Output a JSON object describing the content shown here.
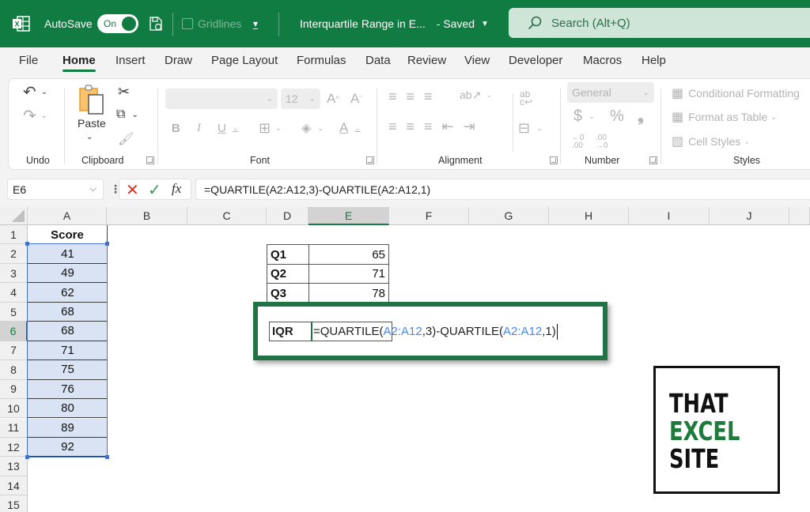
{
  "titlebar": {
    "autosave_label": "AutoSave",
    "autosave_state": "On",
    "gridlines_label": "Gridlines",
    "gridlines_checked": false,
    "doc_title": "Interquartile Range in E...",
    "save_status": "- Saved",
    "search_placeholder": "Search (Alt+Q)",
    "brand_color": "#107C41"
  },
  "tabs": [
    {
      "label": "File",
      "active": false
    },
    {
      "label": "Home",
      "active": true
    },
    {
      "label": "Insert",
      "active": false
    },
    {
      "label": "Draw",
      "active": false
    },
    {
      "label": "Page Layout",
      "active": false
    },
    {
      "label": "Formulas",
      "active": false
    },
    {
      "label": "Data",
      "active": false
    },
    {
      "label": "Review",
      "active": false
    },
    {
      "label": "View",
      "active": false
    },
    {
      "label": "Developer",
      "active": false
    },
    {
      "label": "Macros",
      "active": false
    },
    {
      "label": "Help",
      "active": false
    }
  ],
  "ribbon": {
    "groups": {
      "undo": "Undo",
      "clipboard": "Clipboard",
      "font": "Font",
      "alignment": "Alignment",
      "number": "Number",
      "styles": "Styles"
    },
    "paste_label": "Paste",
    "font_size": "12",
    "number_format": "General",
    "conditional_formatting": "Conditional Formatting",
    "format_as_table": "Format as Table",
    "cell_styles": "Cell Styles"
  },
  "formula_bar": {
    "name_box": "E6",
    "formula": "=QUARTILE(A2:A12,3)-QUARTILE(A2:A12,1)",
    "fx_label": "fx"
  },
  "grid": {
    "columns": [
      "A",
      "B",
      "C",
      "D",
      "E",
      "F",
      "G",
      "H",
      "I",
      "J"
    ],
    "selected_column": "E",
    "rows": [
      "1",
      "2",
      "3",
      "4",
      "5",
      "6",
      "7",
      "8",
      "9",
      "10",
      "11",
      "12",
      "13",
      "14",
      "15"
    ],
    "selected_row": "6",
    "score_header": "Score",
    "scores": [
      "41",
      "49",
      "62",
      "68",
      "68",
      "71",
      "75",
      "76",
      "80",
      "89",
      "92"
    ],
    "quartiles": [
      {
        "label": "Q1",
        "value": "65"
      },
      {
        "label": "Q2",
        "value": "71"
      },
      {
        "label": "Q3",
        "value": "78"
      }
    ],
    "iqr": {
      "label": "IQR",
      "formula_parts": [
        "=QUARTILE(",
        "A2:A12",
        ",3)-QUARTILE(",
        "A2:A12",
        ",1)"
      ]
    }
  },
  "logo": {
    "lines": [
      "THAT",
      "EXCEL",
      "SITE"
    ],
    "accent_color": "#1E7B3C"
  }
}
